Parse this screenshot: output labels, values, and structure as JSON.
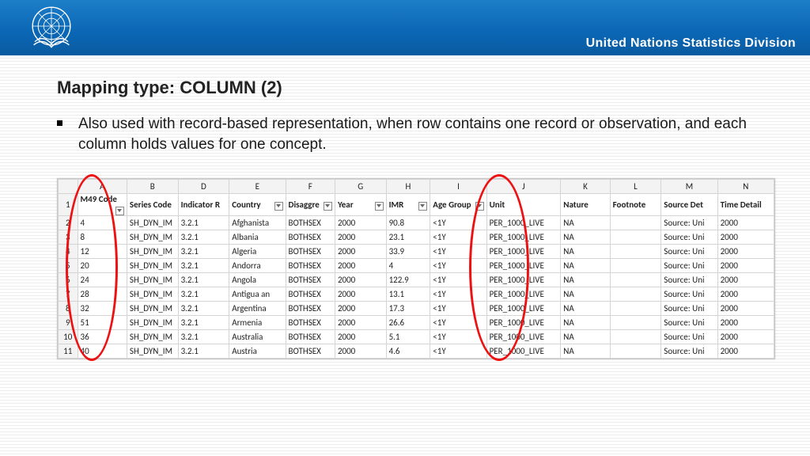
{
  "header": {
    "org": "United Nations Statistics Division"
  },
  "title": "Mapping type: COLUMN (2)",
  "bullet": "Also used with record-based representation, when row contains one record or observation, and each column holds values for one concept.",
  "columnLetters": [
    "A",
    "B",
    "D",
    "E",
    "F",
    "G",
    "H",
    "I",
    "J",
    "K",
    "L",
    "M",
    "N"
  ],
  "headers": {
    "m49": "M49 Code",
    "series": "Series Code",
    "indicator": "Indicator R",
    "country": "Country",
    "disaggre": "Disaggre",
    "year": "Year",
    "imr": "IMR",
    "agegroup": "Age Group",
    "unit": "Unit",
    "nature": "Nature",
    "footnote": "Footnote",
    "sourcedet": "Source Det",
    "timedetail": "Time Detail"
  },
  "rows": [
    {
      "n": "2",
      "m49": "4",
      "series": "SH_DYN_IM",
      "ind": "3.2.1",
      "country": "Afghanista",
      "dis": "BOTHSEX",
      "year": "2000",
      "imr": "90.8",
      "age": "<1Y",
      "unit": "PER_1000_LIVE",
      "nat": "NA",
      "fn": "",
      "src": "Source: Uni",
      "td": "2000"
    },
    {
      "n": "3",
      "m49": "8",
      "series": "SH_DYN_IM",
      "ind": "3.2.1",
      "country": "Albania",
      "dis": "BOTHSEX",
      "year": "2000",
      "imr": "23.1",
      "age": "<1Y",
      "unit": "PER_1000_LIVE",
      "nat": "NA",
      "fn": "",
      "src": "Source: Uni",
      "td": "2000"
    },
    {
      "n": "4",
      "m49": "12",
      "series": "SH_DYN_IM",
      "ind": "3.2.1",
      "country": "Algeria",
      "dis": "BOTHSEX",
      "year": "2000",
      "imr": "33.9",
      "age": "<1Y",
      "unit": "PER_1000_LIVE",
      "nat": "NA",
      "fn": "",
      "src": "Source: Uni",
      "td": "2000"
    },
    {
      "n": "5",
      "m49": "20",
      "series": "SH_DYN_IM",
      "ind": "3.2.1",
      "country": "Andorra",
      "dis": "BOTHSEX",
      "year": "2000",
      "imr": "4",
      "age": "<1Y",
      "unit": "PER_1000_LIVE",
      "nat": "NA",
      "fn": "",
      "src": "Source: Uni",
      "td": "2000"
    },
    {
      "n": "6",
      "m49": "24",
      "series": "SH_DYN_IM",
      "ind": "3.2.1",
      "country": "Angola",
      "dis": "BOTHSEX",
      "year": "2000",
      "imr": "122.9",
      "age": "<1Y",
      "unit": "PER_1000_LIVE",
      "nat": "NA",
      "fn": "",
      "src": "Source: Uni",
      "td": "2000"
    },
    {
      "n": "7",
      "m49": "28",
      "series": "SH_DYN_IM",
      "ind": "3.2.1",
      "country": "Antigua an",
      "dis": "BOTHSEX",
      "year": "2000",
      "imr": "13.1",
      "age": "<1Y",
      "unit": "PER_1000_LIVE",
      "nat": "NA",
      "fn": "",
      "src": "Source: Uni",
      "td": "2000"
    },
    {
      "n": "8",
      "m49": "32",
      "series": "SH_DYN_IM",
      "ind": "3.2.1",
      "country": "Argentina",
      "dis": "BOTHSEX",
      "year": "2000",
      "imr": "17.3",
      "age": "<1Y",
      "unit": "PER_1000_LIVE",
      "nat": "NA",
      "fn": "",
      "src": "Source: Uni",
      "td": "2000"
    },
    {
      "n": "9",
      "m49": "51",
      "series": "SH_DYN_IM",
      "ind": "3.2.1",
      "country": "Armenia",
      "dis": "BOTHSEX",
      "year": "2000",
      "imr": "26.6",
      "age": "<1Y",
      "unit": "PER_1000_LIVE",
      "nat": "NA",
      "fn": "",
      "src": "Source: Uni",
      "td": "2000"
    },
    {
      "n": "10",
      "m49": "36",
      "series": "SH_DYN_IM",
      "ind": "3.2.1",
      "country": "Australia",
      "dis": "BOTHSEX",
      "year": "2000",
      "imr": "5.1",
      "age": "<1Y",
      "unit": "PER_1000_LIVE",
      "nat": "NA",
      "fn": "",
      "src": "Source: Uni",
      "td": "2000"
    },
    {
      "n": "11",
      "m49": "40",
      "series": "SH_DYN_IM",
      "ind": "3.2.1",
      "country": "Austria",
      "dis": "BOTHSEX",
      "year": "2000",
      "imr": "4.6",
      "age": "<1Y",
      "unit": "PER_1000_LIVE",
      "nat": "NA",
      "fn": "",
      "src": "Source: Uni",
      "td": "2000"
    }
  ]
}
